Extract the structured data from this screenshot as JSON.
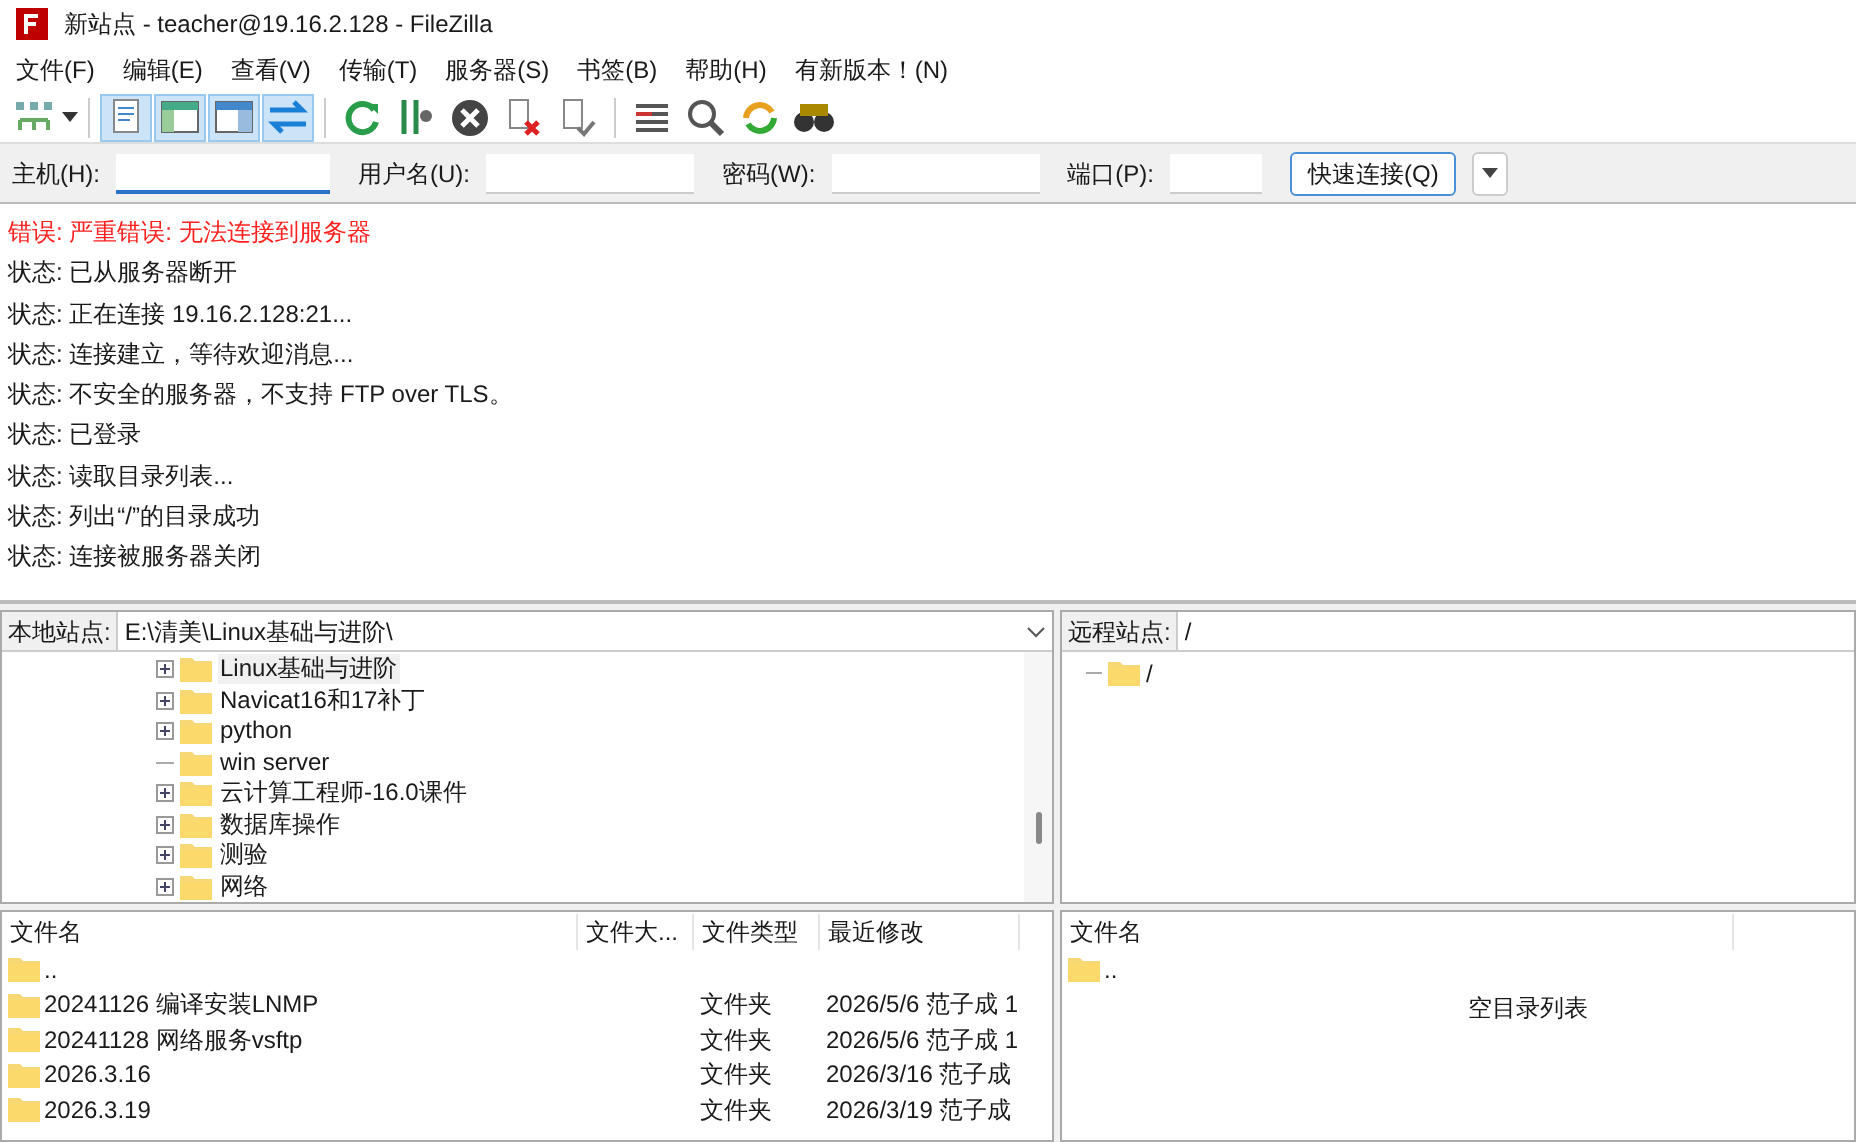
{
  "window": {
    "title": "新站点 - teacher@19.16.2.128 - FileZilla"
  },
  "menu": [
    "文件(F)",
    "编辑(E)",
    "查看(V)",
    "传输(T)",
    "服务器(S)",
    "书签(B)",
    "帮助(H)",
    "有新版本！(N)"
  ],
  "toolbar": [
    {
      "kind": "site-manager",
      "on": false
    },
    {
      "kind": "log",
      "on": true
    },
    {
      "kind": "local-tree",
      "on": true
    },
    {
      "kind": "remote-tree",
      "on": true
    },
    {
      "kind": "queue",
      "on": true
    },
    {
      "kind": "refresh",
      "on": false
    },
    {
      "kind": "filter",
      "on": false
    },
    {
      "kind": "cancel",
      "on": false
    },
    {
      "kind": "disconnect",
      "on": false
    },
    {
      "kind": "reconnect",
      "on": false
    },
    {
      "kind": "list",
      "on": false
    },
    {
      "kind": "search",
      "on": false
    },
    {
      "kind": "sync",
      "on": false
    },
    {
      "kind": "find",
      "on": false
    }
  ],
  "quickconnect": {
    "host_label": "主机(H):",
    "user_label": "用户名(U):",
    "password_label": "密码(W):",
    "port_label": "端口(P):",
    "button": "快速连接(Q)"
  },
  "log": [
    {
      "kind": "error",
      "text": "错误: 严重错误: 无法连接到服务器"
    },
    {
      "kind": "status",
      "text": "状态: 已从服务器断开"
    },
    {
      "kind": "status",
      "text": "状态: 正在连接 19.16.2.128:21..."
    },
    {
      "kind": "status",
      "text": "状态: 连接建立，等待欢迎消息..."
    },
    {
      "kind": "status",
      "text": "状态: 不安全的服务器，不支持 FTP over TLS。"
    },
    {
      "kind": "status",
      "text": "状态: 已登录"
    },
    {
      "kind": "status",
      "text": "状态: 读取目录列表..."
    },
    {
      "kind": "status",
      "text": "状态: 列出“/”的目录成功"
    },
    {
      "kind": "status",
      "text": "状态: 连接被服务器关闭"
    }
  ],
  "local": {
    "label": "本地站点:",
    "path": "E:\\清美\\Linux基础与进阶\\",
    "tree": [
      {
        "name": "Linux基础与进阶",
        "expandable": true,
        "selected": true
      },
      {
        "name": "Navicat16和17补丁",
        "expandable": true,
        "selected": false
      },
      {
        "name": "python",
        "expandable": true,
        "selected": false
      },
      {
        "name": "win server",
        "expandable": false,
        "selected": false
      },
      {
        "name": "云计算工程师-16.0课件",
        "expandable": true,
        "selected": false
      },
      {
        "name": "数据库操作",
        "expandable": true,
        "selected": false
      },
      {
        "name": "测验",
        "expandable": true,
        "selected": false
      },
      {
        "name": "网络",
        "expandable": true,
        "selected": false
      }
    ],
    "columns": [
      "文件名",
      "文件大...",
      "文件类型",
      "最近修改"
    ],
    "rows": [
      {
        "name": "..",
        "size": "",
        "type": "",
        "modified": ""
      },
      {
        "name": "20241126 编译安装LNMP",
        "type": "文件夹",
        "modified": "2026/5/6 范子成 1"
      },
      {
        "name": "20241128 网络服务vsftp",
        "type": "文件夹",
        "modified": "2026/5/6 范子成 1"
      },
      {
        "name": "2026.3.16",
        "type": "文件夹",
        "modified": "2026/3/16 范子成"
      },
      {
        "name": "2026.3.19",
        "type": "文件夹",
        "modified": "2026/3/19 范子成"
      }
    ]
  },
  "remote": {
    "label": "远程站点:",
    "path": "/",
    "tree": [
      {
        "name": "/"
      }
    ],
    "columns": [
      "文件名"
    ],
    "rows": [
      {
        "name": ".."
      }
    ],
    "empty_message": "空目录列表"
  }
}
